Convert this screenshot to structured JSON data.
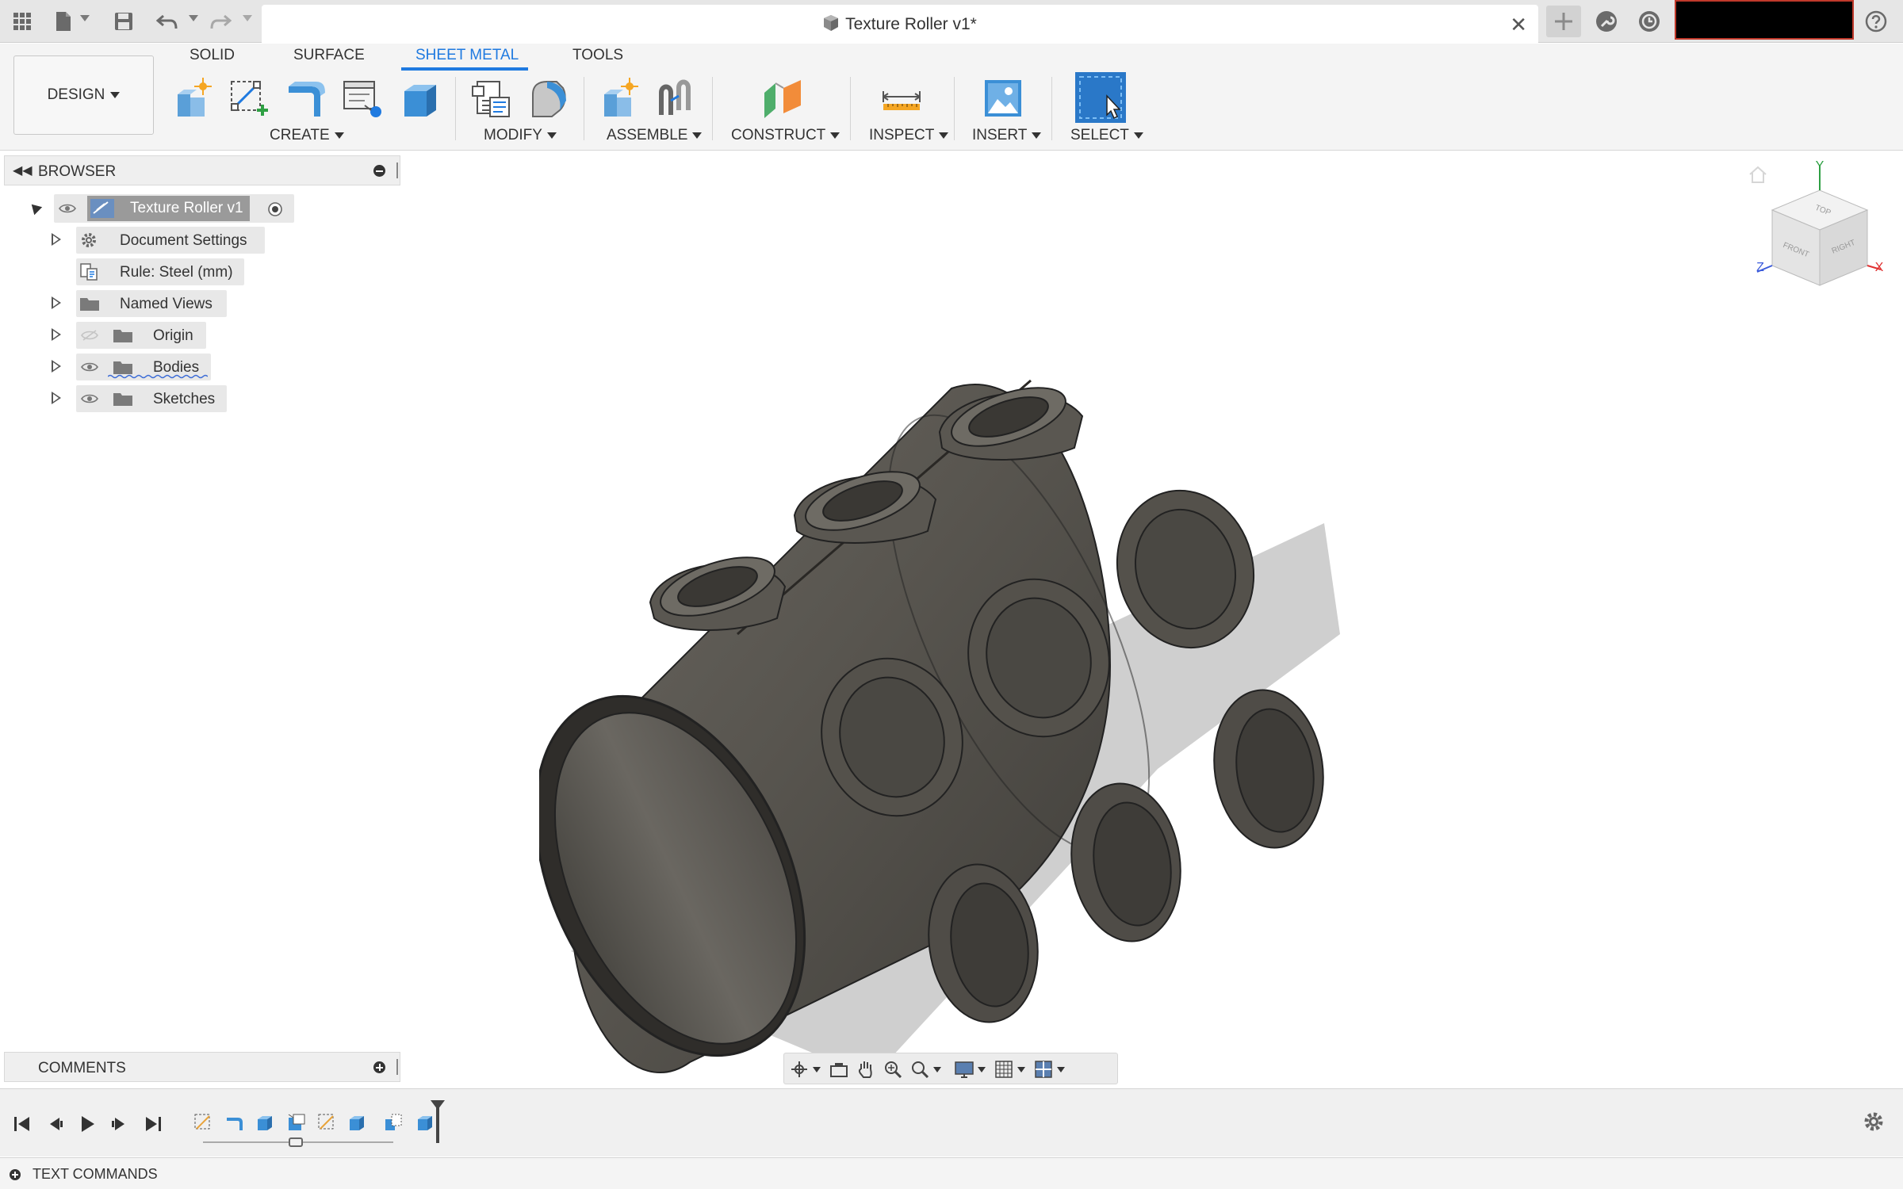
{
  "window": {
    "document_title": "Texture Roller v1*"
  },
  "ribbon": {
    "workspace_label": "DESIGN",
    "tabs": [
      "SOLID",
      "SURFACE",
      "SHEET METAL",
      "TOOLS"
    ],
    "active_tab": "SHEET METAL",
    "groups": [
      "CREATE",
      "MODIFY",
      "ASSEMBLE",
      "CONSTRUCT",
      "INSPECT",
      "INSERT",
      "SELECT"
    ]
  },
  "browser": {
    "title": "BROWSER",
    "root": "Texture Roller v1",
    "items": [
      {
        "label": "Document Settings",
        "icon": "gear-icon"
      },
      {
        "label": "Rule: Steel (mm)",
        "icon": "rule-icon"
      },
      {
        "label": "Named Views",
        "icon": "folder-icon"
      },
      {
        "label": "Origin",
        "icon": "folder-icon"
      },
      {
        "label": "Bodies",
        "icon": "folder-icon"
      },
      {
        "label": "Sketches",
        "icon": "folder-icon"
      }
    ]
  },
  "viewcube": {
    "faces": [
      "TOP",
      "FRONT",
      "RIGHT"
    ],
    "axes": [
      "Y",
      "Z",
      "X"
    ]
  },
  "comments": {
    "title": "COMMENTS"
  },
  "text_commands": {
    "title": "TEXT COMMANDS"
  },
  "colors": {
    "accent": "#1f7ae0",
    "model_body": "#5b5852",
    "select_icon": "#2a78c8"
  }
}
